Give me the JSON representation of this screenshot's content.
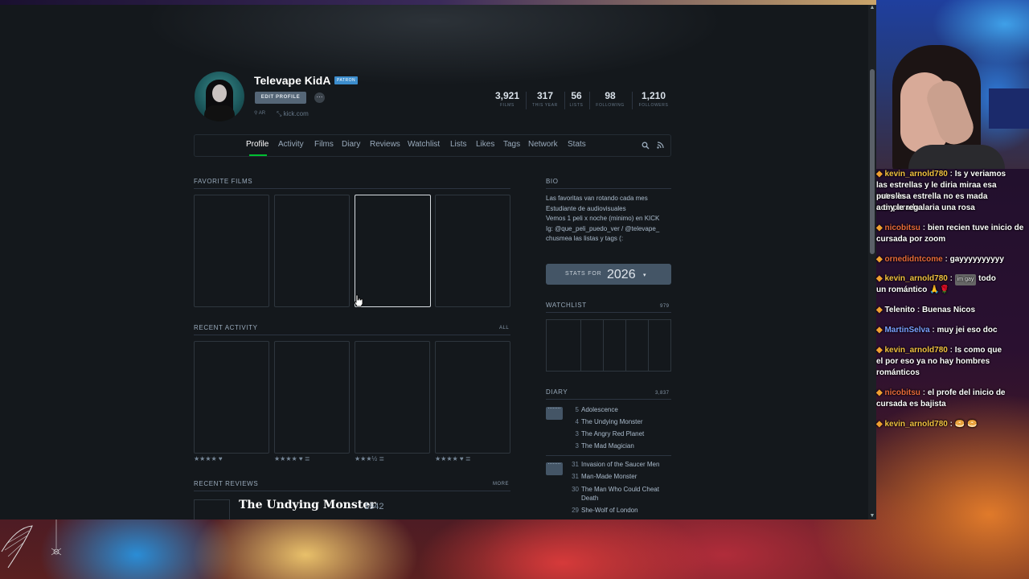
{
  "profile": {
    "username": "Televape KidA",
    "badge": "PATRON",
    "edit_label": "EDIT PROFILE",
    "more_label": "⋯",
    "location": "AR",
    "website": "kick.com"
  },
  "stats": [
    {
      "num": "3,921",
      "label": "FILMS"
    },
    {
      "num": "317",
      "label": "THIS YEAR"
    },
    {
      "num": "56",
      "label": "LISTS"
    },
    {
      "num": "98",
      "label": "FOLLOWING"
    },
    {
      "num": "1,210",
      "label": "FOLLOWERS"
    }
  ],
  "nav": [
    "Profile",
    "Activity",
    "Films",
    "Diary",
    "Reviews",
    "Watchlist",
    "Lists",
    "Likes",
    "Tags",
    "Network",
    "Stats"
  ],
  "favorites": {
    "heading": "FAVORITE FILMS"
  },
  "recent_activity": {
    "heading": "RECENT ACTIVITY",
    "link": "ALL",
    "ratings": [
      "★★★★ ♥",
      "★★★★ ♥ ≣",
      "★★★½ ≣",
      "★★★★ ♥ ≣"
    ]
  },
  "recent_reviews": {
    "heading": "RECENT REVIEWS",
    "link": "MORE",
    "first_title": "The Undying Monster",
    "first_year": "1942"
  },
  "bio": {
    "heading": "BIO",
    "lines": [
      "Las favoritas van rotando cada mes",
      "Estudiante de audiovisuales",
      "Vemos 1 peli x noche (minimo) en KICK",
      "Ig: @que_peli_puedo_ver / @televape_",
      "chusmea las listas y tags (:"
    ]
  },
  "stats_button": {
    "label": "STATS FOR",
    "year": "2026",
    "caret": "▾"
  },
  "watchlist": {
    "heading": "WATCHLIST",
    "count": "979"
  },
  "diary": {
    "heading": "DIARY",
    "count": "3,837",
    "entries": [
      {
        "day": "5",
        "title": "Adolescence"
      },
      {
        "day": "4",
        "title": "The Undying Monster"
      },
      {
        "day": "3",
        "title": "The Angry Red Planet"
      },
      {
        "day": "3",
        "title": "The Mad Magician"
      },
      {
        "day": "31",
        "title": "Invasion of the Saucer Men"
      },
      {
        "day": "31",
        "title": "Man-Made Monster"
      },
      {
        "day": "30",
        "title": "The Man Who Could Cheat"
      },
      {
        "day": "",
        "title": "Death"
      },
      {
        "day": "29",
        "title": "She-Wolf of London"
      }
    ]
  },
  "chat": [
    {
      "user": "kevin_arnold780",
      "msg": "Is y veriamos",
      "cont": [
        "las estrellas y le diria miraa esa estrella",
        "pues esa estrella no es mada comparada",
        "a ti y le regalaria una rosa"
      ]
    },
    {
      "user": "nicobitsu",
      "msg": "bien recien tuve inicio de",
      "cont": [
        "cursada por zoom"
      ]
    },
    {
      "user": "ornedidntcome",
      "msg": "gayyyyyyyyyy",
      "cont": []
    },
    {
      "user": "kevin_arnold780",
      "tag": "im gay",
      "msg": "todo",
      "cont": [
        "un romántico 🙏🌹"
      ]
    },
    {
      "user": "Telenito",
      "msg": "Buenas Nicos",
      "cont": []
    },
    {
      "user": "MartinSelva",
      "msg": "muy jei eso doc",
      "cont": []
    },
    {
      "user": "kevin_arnold780",
      "msg": "Is como que",
      "cont": [
        "el por eso ya no hay hombres",
        "románticos"
      ]
    },
    {
      "user": "nicobitsu",
      "msg": "el profe del inicio de",
      "cont": [
        "cursada es bajista"
      ]
    },
    {
      "user": "kevin_arnold780",
      "msg": "",
      "cont": []
    }
  ],
  "colors": {
    "accent_green": "#00c030",
    "patron_blue": "#3c8dcd",
    "page_bg": "#14181c"
  },
  "icons": [
    "search-icon",
    "rss-icon",
    "location-icon",
    "link-icon",
    "calendar-icon",
    "hand-cursor-icon"
  ]
}
